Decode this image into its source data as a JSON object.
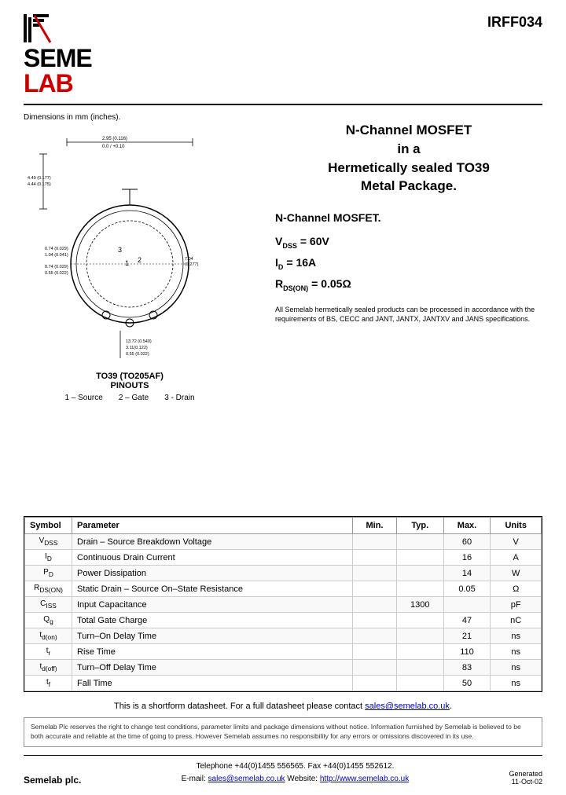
{
  "header": {
    "part_number": "IRFF034"
  },
  "product": {
    "title_line1": "N-Channel MOSFET",
    "title_line2": "in a",
    "title_line3": "Hermetically sealed TO39",
    "title_line4": "Metal Package.",
    "n_channel_label": "N-Channel MOSFET.",
    "vdss_label": "V",
    "vdss_sub": "DSS",
    "vdss_value": "= 60V",
    "id_label": "I",
    "id_sub": "D",
    "id_value": "= 16A",
    "rds_label": "R",
    "rds_sub": "DS(ON)",
    "rds_value": "= 0.05Ω",
    "compliance_text": "All Semelab hermetically sealed products can be processed in accordance with the requirements of BS, CECC and JANT, JANTX, JANTXV and JANS specifications."
  },
  "dimensions_label": "Dimensions in mm (inches).",
  "package": {
    "name": "TO39 (TO205AF)",
    "pinouts_label": "PINOUTS",
    "pin1": "1 – Source",
    "pin2": "2 – Gate",
    "pin3": "3 - Drain"
  },
  "table": {
    "headers": [
      "Symbol",
      "Parameter",
      "Min.",
      "Typ.",
      "Max.",
      "Units"
    ],
    "rows": [
      {
        "symbol": "V_DSS",
        "symbol_display": "V<sub>DSS</sub>",
        "parameter": "Drain – Source Breakdown Voltage",
        "min": "",
        "typ": "",
        "max": "60",
        "units": "V"
      },
      {
        "symbol": "I_D",
        "symbol_display": "I<sub>D</sub>",
        "parameter": "Continuous Drain Current",
        "min": "",
        "typ": "",
        "max": "16",
        "units": "A"
      },
      {
        "symbol": "P_D",
        "symbol_display": "P<sub>D</sub>",
        "parameter": "Power Dissipation",
        "min": "",
        "typ": "",
        "max": "14",
        "units": "W"
      },
      {
        "symbol": "R_DS(ON)",
        "symbol_display": "R<sub>DS(ON)</sub>",
        "parameter": "Static Drain – Source On–State Resistance",
        "min": "",
        "typ": "",
        "max": "0.05",
        "units": "Ω"
      },
      {
        "symbol": "C_ISS",
        "symbol_display": "C<sub>ISS</sub>",
        "parameter": "Input Capacitance",
        "min": "",
        "typ": "1300",
        "max": "",
        "units": "pF"
      },
      {
        "symbol": "Q_g",
        "symbol_display": "Q<sub>g</sub>",
        "parameter": "Total Gate Charge",
        "min": "",
        "typ": "",
        "max": "47",
        "units": "nC"
      },
      {
        "symbol": "t_d(on)",
        "symbol_display": "t<sub>d(on)</sub>",
        "parameter": "Turn–On Delay Time",
        "min": "",
        "typ": "",
        "max": "21",
        "units": "ns"
      },
      {
        "symbol": "t_r",
        "symbol_display": "t<sub>r</sub>",
        "parameter": "Rise Time",
        "min": "",
        "typ": "",
        "max": "110",
        "units": "ns"
      },
      {
        "symbol": "t_d(off)",
        "symbol_display": "t<sub>d(off)</sub>",
        "parameter": "Turn–Off Delay Time",
        "min": "",
        "typ": "",
        "max": "83",
        "units": "ns"
      },
      {
        "symbol": "t_f",
        "symbol_display": "t<sub>f</sub>",
        "parameter": "Fall Time",
        "min": "",
        "typ": "",
        "max": "50",
        "units": "ns"
      }
    ]
  },
  "shortform_note": "This is a shortform datasheet. For a full datasheet please contact ",
  "shortform_email": "sales@semelab.co.uk",
  "disclaimer": "Semelab Plc reserves the right to change test conditions, parameter limits and package dimensions without notice. Information furnished by Semelab is believed to be both accurate and reliable at the time of going to press. However Semelab assumes no responsibility for any errors or omissions discovered in its use.",
  "footer": {
    "company": "Semelab plc.",
    "telephone": "Telephone +44(0)1455 556565.  Fax +44(0)1455 552612.",
    "email_label": "E-mail: ",
    "email": "sales@semelab.co.uk",
    "website_label": "  Website: ",
    "website": "http://www.semelab.co.uk",
    "generated_label": "Generated",
    "generated_date": "11-Oct-02"
  }
}
